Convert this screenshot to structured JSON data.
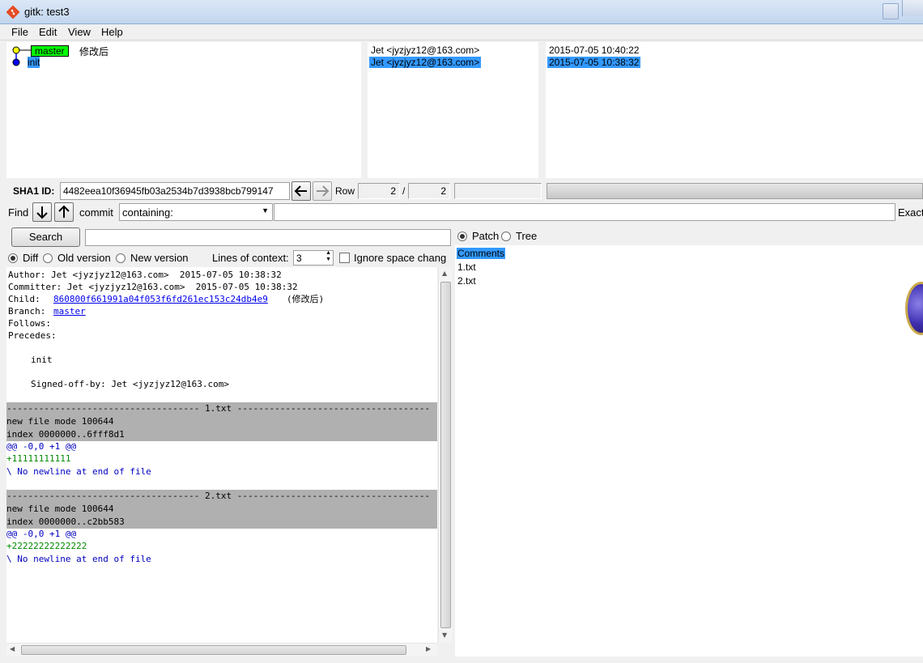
{
  "window": {
    "title": "gitk: test3"
  },
  "menu": [
    "File",
    "Edit",
    "View",
    "Help"
  ],
  "commits": [
    {
      "branch": "master",
      "message": "修改后",
      "author": "Jet <jyzjyz12@163.com>",
      "date": "2015-07-05 10:40:22",
      "selected": false
    },
    {
      "branch": "",
      "message": "init",
      "author": "Jet <jyzjyz12@163.com>",
      "date": "2015-07-05 10:38:32",
      "selected": true
    }
  ],
  "sha": {
    "label": "SHA1 ID:",
    "value": "4482eea10f36945fb03a2534b7d3938bcb799147",
    "row_label": "Row",
    "row_current": "2",
    "row_sep": "/",
    "row_total": "2"
  },
  "find": {
    "label": "Find",
    "type": "commit",
    "mode": "containing:",
    "exact_label": "Exact"
  },
  "search": {
    "button": "Search"
  },
  "diff_options": {
    "diff": "Diff",
    "old_version": "Old version",
    "new_version": "New version",
    "lines_of_context_label": "Lines of context:",
    "lines_of_context_value": "3",
    "ignore_space": "Ignore space chang"
  },
  "view_mode": {
    "patch": "Patch",
    "tree": "Tree"
  },
  "file_list": [
    "Comments",
    "1.txt",
    "2.txt"
  ],
  "diff": {
    "author": "Author: Jet <jyzjyz12@163.com>  2015-07-05 10:38:32",
    "committer": "Committer: Jet <jyzjyz12@163.com>  2015-07-05 10:38:32",
    "child_label": "Child:",
    "child_sha": "860800f661991a04f053f6fd261ec153c24db4e9",
    "child_msg": "(修改后)",
    "branch_label": "Branch:",
    "branch_name": "master",
    "follows": "Follows:",
    "precedes": "Precedes:",
    "message": "init",
    "signoff": "Signed-off-by: Jet <jyzjyz12@163.com>",
    "files": [
      {
        "header": "------------------------------------ 1.txt ------------------------------------",
        "mode": "new file mode 100644",
        "index": "index 0000000..6fff8d1",
        "hunk": "@@ -0,0 +1 @@",
        "added": "+11111111111",
        "note": "\\ No newline at end of file"
      },
      {
        "header": "------------------------------------ 2.txt ------------------------------------",
        "mode": "new file mode 100644",
        "index": "index 0000000..c2bb583",
        "hunk": "@@ -0,0 +1 @@",
        "added": "+22222222222222",
        "note": "\\ No newline at end of file"
      }
    ]
  }
}
